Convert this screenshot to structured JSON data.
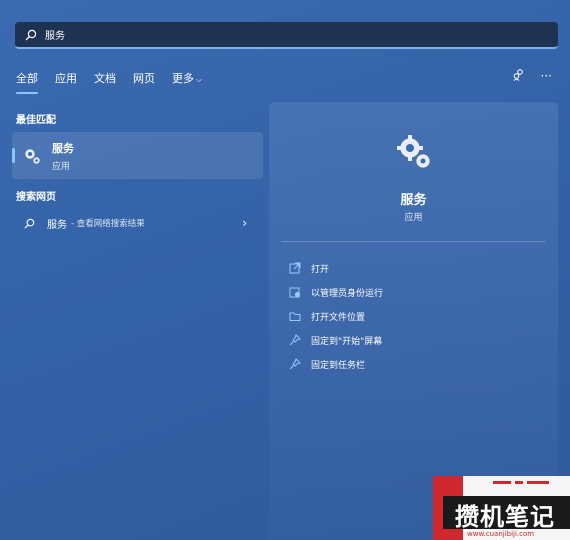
{
  "search": {
    "value": "服务",
    "placeholder": ""
  },
  "tabs": [
    {
      "label": "全部"
    },
    {
      "label": "应用"
    },
    {
      "label": "文档"
    },
    {
      "label": "网页"
    },
    {
      "label": "更多"
    }
  ],
  "sections": {
    "best_match": "最佳匹配",
    "search_web": "搜索网页"
  },
  "best_match": {
    "name": "服务",
    "type": "应用"
  },
  "web_result": {
    "query": "服务",
    "hint": "- 查看网络搜索结果"
  },
  "detail": {
    "name": "服务",
    "type": "应用",
    "actions": [
      {
        "label": "打开",
        "icon": "open-icon"
      },
      {
        "label": "以管理员身份运行",
        "icon": "shield-icon"
      },
      {
        "label": "打开文件位置",
        "icon": "folder-icon"
      },
      {
        "label": "固定到\"开始\"屏幕",
        "icon": "pin-icon"
      },
      {
        "label": "固定到任务栏",
        "icon": "pin-icon"
      }
    ]
  },
  "watermark": {
    "text": "攒机笔记",
    "url": "www.cuanjibiji.com"
  },
  "colors": {
    "accent": "#8cc4ff",
    "search_bg": "#1e3252",
    "watermark_red": "#d1282e"
  }
}
